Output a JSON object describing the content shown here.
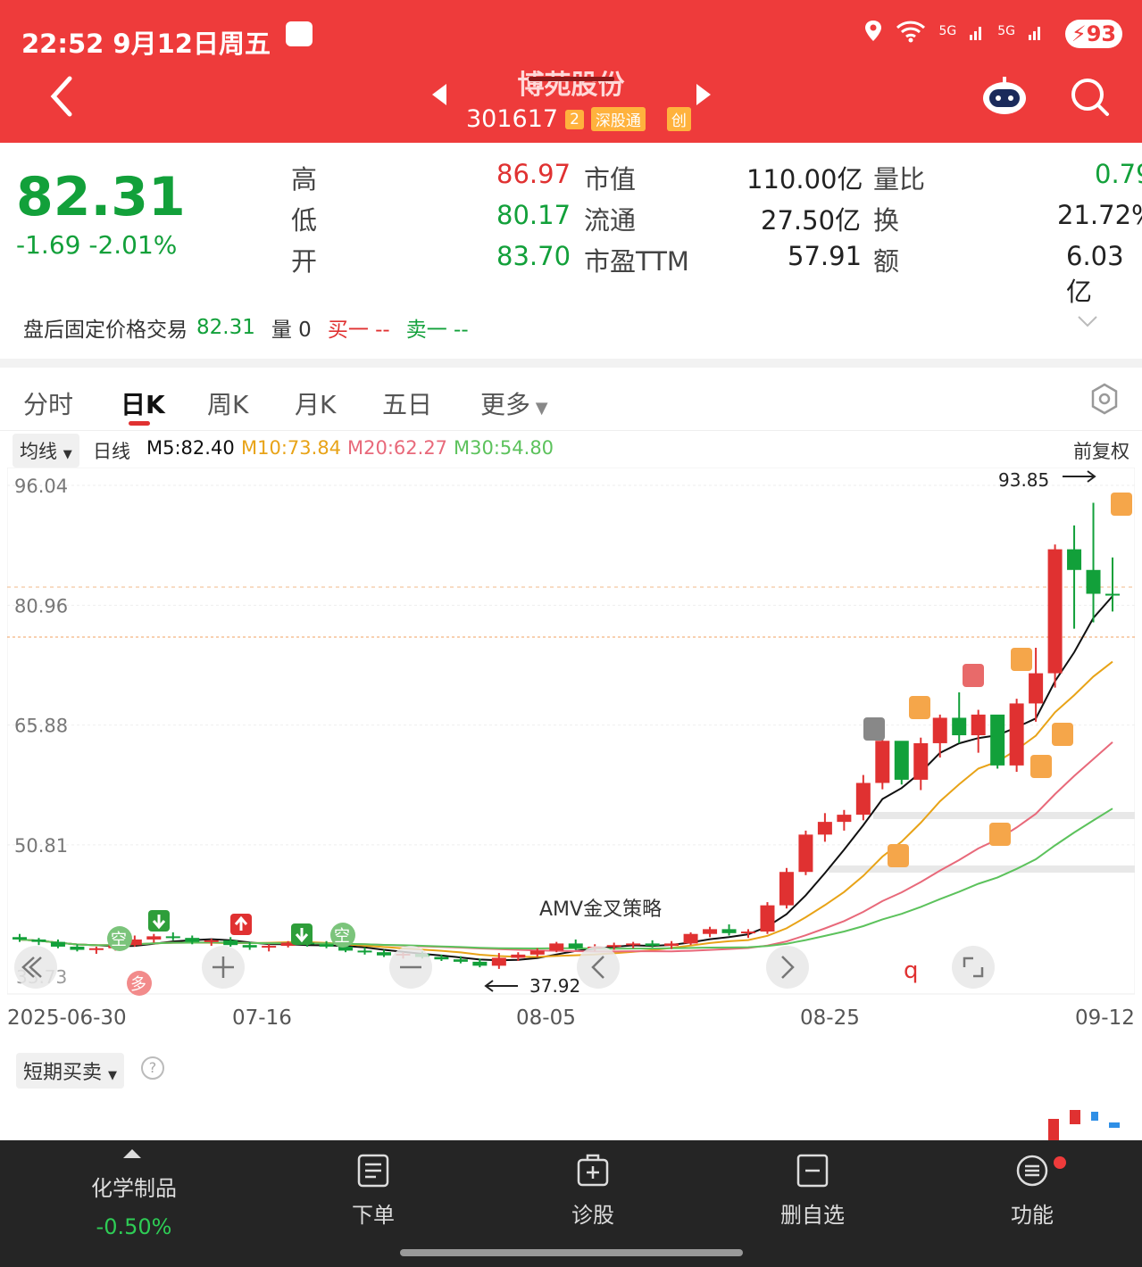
{
  "status": {
    "time": "22:52",
    "date": "9月12日周五",
    "battery": "93",
    "net1": "5G",
    "net2": "5G"
  },
  "header": {
    "title": "博苑股份",
    "code": "301617",
    "tags": [
      "2",
      "深股通",
      "创"
    ]
  },
  "quote": {
    "price": "82.31",
    "change": "-1.69",
    "change_pct": "-2.01%",
    "rows": [
      {
        "l1": "高",
        "v1": "86.97",
        "l2": "市值",
        "v2": "110.00亿",
        "l3": "量比",
        "v3": "0.79"
      },
      {
        "l1": "低",
        "v1": "80.17",
        "l2": "流通",
        "v2": "27.50亿",
        "l3": "换",
        "v3": "21.72%"
      },
      {
        "l1": "开",
        "v1": "83.70",
        "l2": "市盈TTM",
        "v2": "57.91",
        "l3": "额",
        "v3": "6.03亿"
      }
    ]
  },
  "post_trade": {
    "label": "盘后固定价格交易",
    "price": "82.31",
    "vol_label": "量",
    "vol": "0",
    "buy": "买一 --",
    "sell": "卖一 --"
  },
  "tabs": [
    "分时",
    "日K",
    "周K",
    "月K",
    "五日",
    "更多"
  ],
  "ma": {
    "btn": "均线",
    "line": "日线",
    "m5": "M5:82.40",
    "m10": "M10:73.84",
    "m20": "M20:62.27",
    "m30": "M30:54.80",
    "adjust": "前复权"
  },
  "colors": {
    "up": "#e03131",
    "down": "#12a03a",
    "m5": "#111111",
    "m10": "#e8a317",
    "m20": "#e8697a",
    "m30": "#5cc25c"
  },
  "chart_data": {
    "type": "candlestick",
    "y_ticks": [
      "96.04",
      "80.96",
      "65.88",
      "50.81"
    ],
    "ylim": [
      33.73,
      96.04
    ],
    "low_label": "33.73",
    "x_ticks": [
      "2025-06-30",
      "07-16",
      "08-05",
      "08-25",
      "09-12"
    ],
    "annotations": {
      "high": "93.85",
      "low": "37.92",
      "strategy": "AMV金叉策略"
    },
    "candles": [
      [
        39.2,
        39.6,
        38.6,
        38.9
      ],
      [
        38.9,
        39.1,
        38.2,
        38.6
      ],
      [
        38.6,
        38.9,
        37.8,
        38.0
      ],
      [
        38.0,
        38.3,
        37.4,
        37.6
      ],
      [
        37.6,
        38.0,
        37.1,
        37.8
      ],
      [
        37.8,
        38.5,
        37.5,
        38.2
      ],
      [
        38.2,
        39.4,
        38.0,
        38.9
      ],
      [
        38.9,
        39.6,
        38.5,
        39.3
      ],
      [
        39.3,
        39.8,
        38.8,
        39.1
      ],
      [
        39.1,
        39.4,
        38.3,
        38.6
      ],
      [
        38.6,
        39.0,
        38.1,
        38.8
      ],
      [
        38.8,
        39.2,
        38.0,
        38.2
      ],
      [
        38.2,
        38.6,
        37.6,
        37.9
      ],
      [
        37.9,
        38.3,
        37.4,
        38.1
      ],
      [
        38.1,
        38.7,
        37.9,
        38.5
      ],
      [
        38.5,
        38.9,
        38.0,
        38.3
      ],
      [
        38.3,
        38.7,
        37.8,
        38.0
      ],
      [
        38.0,
        38.4,
        37.3,
        37.5
      ],
      [
        37.5,
        37.9,
        37.0,
        37.3
      ],
      [
        37.3,
        37.6,
        36.7,
        36.9
      ],
      [
        36.9,
        37.3,
        36.5,
        37.1
      ],
      [
        37.1,
        37.4,
        36.5,
        36.7
      ],
      [
        36.7,
        37.0,
        36.2,
        36.4
      ],
      [
        36.4,
        36.8,
        35.9,
        36.1
      ],
      [
        36.1,
        36.5,
        35.4,
        35.6
      ],
      [
        35.6,
        37.2,
        35.2,
        36.6
      ],
      [
        36.6,
        37.3,
        36.2,
        37.0
      ],
      [
        37.0,
        37.8,
        36.7,
        37.5
      ],
      [
        37.5,
        38.6,
        37.3,
        38.4
      ],
      [
        38.4,
        38.9,
        37.6,
        37.8
      ],
      [
        37.8,
        38.3,
        37.4,
        38.0
      ],
      [
        38.0,
        38.5,
        37.6,
        38.2
      ],
      [
        38.2,
        38.6,
        37.8,
        38.4
      ],
      [
        38.4,
        38.8,
        37.9,
        38.1
      ],
      [
        38.1,
        38.7,
        37.7,
        38.4
      ],
      [
        38.4,
        39.8,
        38.2,
        39.6
      ],
      [
        39.6,
        40.5,
        39.2,
        40.2
      ],
      [
        40.2,
        40.8,
        39.4,
        39.7
      ],
      [
        39.7,
        40.2,
        39.1,
        39.9
      ],
      [
        39.9,
        43.6,
        39.6,
        43.2
      ],
      [
        43.2,
        47.9,
        42.8,
        47.4
      ],
      [
        47.4,
        52.6,
        47.0,
        52.1
      ],
      [
        52.1,
        54.8,
        51.2,
        53.7
      ],
      [
        53.7,
        55.2,
        52.6,
        54.6
      ],
      [
        54.6,
        59.6,
        53.9,
        58.6
      ],
      [
        58.6,
        64.2,
        57.8,
        63.9
      ],
      [
        63.9,
        62.0,
        58.4,
        59.0
      ],
      [
        59.0,
        64.3,
        57.7,
        63.6
      ],
      [
        63.6,
        67.2,
        61.8,
        66.8
      ],
      [
        66.8,
        70.0,
        63.6,
        64.6
      ],
      [
        64.6,
        67.8,
        62.4,
        67.2
      ],
      [
        67.2,
        66.0,
        60.4,
        60.8
      ],
      [
        60.8,
        69.2,
        60.0,
        68.6
      ],
      [
        68.6,
        75.6,
        66.3,
        72.4
      ],
      [
        72.4,
        88.6,
        70.6,
        88.0
      ],
      [
        88.0,
        91.0,
        78.0,
        85.4
      ],
      [
        85.4,
        93.85,
        78.8,
        82.4
      ],
      [
        82.4,
        86.97,
        80.17,
        82.31
      ]
    ]
  },
  "sub_indicator": "短期买卖",
  "bottom": {
    "sector": "化学制品",
    "sector_change": "-0.50%",
    "items": [
      "下单",
      "诊股",
      "删自选",
      "功能"
    ]
  }
}
